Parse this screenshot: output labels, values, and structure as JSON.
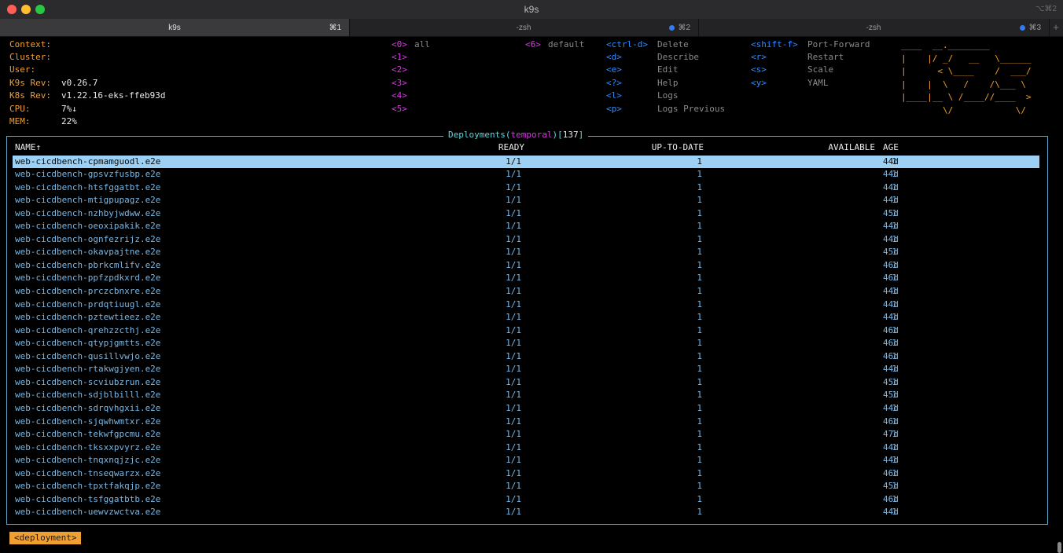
{
  "window": {
    "title": "k9s",
    "shortcut": "⌥⌘2"
  },
  "tabs": [
    {
      "label": "k9s",
      "key": "⌘1",
      "active": true,
      "dot": false
    },
    {
      "label": "-zsh",
      "key": "⌘2",
      "active": false,
      "dot": true
    },
    {
      "label": "-zsh",
      "key": "⌘3",
      "active": false,
      "dot": true
    }
  ],
  "new_tab_label": "+",
  "info": {
    "context_label": "Context:",
    "cluster_label": "Cluster:",
    "user_label": "User:",
    "k9s_rev_label": "K9s Rev:",
    "k9s_rev": "v0.26.7",
    "k8s_rev_label": "K8s Rev:",
    "k8s_rev": "v1.22.16-eks-ffeb93d",
    "cpu_label": "CPU:",
    "cpu": "7%↓",
    "mem_label": "MEM:",
    "mem": "22%"
  },
  "namespaces": [
    {
      "key": "<0>",
      "label": "all"
    },
    {
      "key": "<1>",
      "label": ""
    },
    {
      "key": "<2>",
      "label": ""
    },
    {
      "key": "<3>",
      "label": ""
    },
    {
      "key": "<4>",
      "label": ""
    },
    {
      "key": "<5>",
      "label": ""
    },
    {
      "key": "<6>",
      "label": "default"
    }
  ],
  "hotkeys_col1": [
    {
      "key": "<ctrl-d>",
      "label": "Delete"
    },
    {
      "key": "<d>",
      "label": "Describe"
    },
    {
      "key": "<e>",
      "label": "Edit"
    },
    {
      "key": "<?>",
      "label": "Help"
    },
    {
      "key": "<l>",
      "label": "Logs"
    },
    {
      "key": "<p>",
      "label": "Logs Previous"
    }
  ],
  "hotkeys_col2": [
    {
      "key": "<shift-f>",
      "label": "Port-Forward"
    },
    {
      "key": "<r>",
      "label": "Restart"
    },
    {
      "key": "<s>",
      "label": "Scale"
    },
    {
      "key": "<y>",
      "label": "YAML"
    }
  ],
  "logo": "____  __.________\n|    |/ _/   __   \\______\n|      < \\____    /  ___/\n|    |  \\   /    /\\___ \\\n|____|__ \\ /____//____  >\n        \\/            \\/",
  "table": {
    "title_prefix": "Deployments(",
    "namespace": "temporal",
    "title_mid": ")[",
    "count": "137",
    "title_suffix": "]",
    "headers": {
      "name": "NAME↑",
      "ready": "READY",
      "up_to_date": "UP-TO-DATE",
      "available": "AVAILABLE",
      "age": "AGE"
    },
    "selected_index": 0,
    "rows": [
      {
        "name": "web-cicdbench-cpmamguodl.e2e",
        "ready": "1/1",
        "up_to_date": "1",
        "available": "1",
        "age": "44d"
      },
      {
        "name": "web-cicdbench-gpsvzfusbp.e2e",
        "ready": "1/1",
        "up_to_date": "1",
        "available": "1",
        "age": "44d"
      },
      {
        "name": "web-cicdbench-htsfggatbt.e2e",
        "ready": "1/1",
        "up_to_date": "1",
        "available": "1",
        "age": "44d"
      },
      {
        "name": "web-cicdbench-mtigpupagz.e2e",
        "ready": "1/1",
        "up_to_date": "1",
        "available": "1",
        "age": "44d"
      },
      {
        "name": "web-cicdbench-nzhbyjwdww.e2e",
        "ready": "1/1",
        "up_to_date": "1",
        "available": "1",
        "age": "45d"
      },
      {
        "name": "web-cicdbench-oeoxipakik.e2e",
        "ready": "1/1",
        "up_to_date": "1",
        "available": "1",
        "age": "44d"
      },
      {
        "name": "web-cicdbench-ognfezrijz.e2e",
        "ready": "1/1",
        "up_to_date": "1",
        "available": "1",
        "age": "44d"
      },
      {
        "name": "web-cicdbench-okavpajtne.e2e",
        "ready": "1/1",
        "up_to_date": "1",
        "available": "1",
        "age": "45d"
      },
      {
        "name": "web-cicdbench-pbrkcmlifv.e2e",
        "ready": "1/1",
        "up_to_date": "1",
        "available": "1",
        "age": "46d"
      },
      {
        "name": "web-cicdbench-ppfzpdkxrd.e2e",
        "ready": "1/1",
        "up_to_date": "1",
        "available": "1",
        "age": "46d"
      },
      {
        "name": "web-cicdbench-prczcbnxre.e2e",
        "ready": "1/1",
        "up_to_date": "1",
        "available": "1",
        "age": "44d"
      },
      {
        "name": "web-cicdbench-prdqtiuugl.e2e",
        "ready": "1/1",
        "up_to_date": "1",
        "available": "1",
        "age": "44d"
      },
      {
        "name": "web-cicdbench-pztewtieez.e2e",
        "ready": "1/1",
        "up_to_date": "1",
        "available": "1",
        "age": "44d"
      },
      {
        "name": "web-cicdbench-qrehzzcthj.e2e",
        "ready": "1/1",
        "up_to_date": "1",
        "available": "1",
        "age": "46d"
      },
      {
        "name": "web-cicdbench-qtypjgmtts.e2e",
        "ready": "1/1",
        "up_to_date": "1",
        "available": "1",
        "age": "46d"
      },
      {
        "name": "web-cicdbench-qusillvwjo.e2e",
        "ready": "1/1",
        "up_to_date": "1",
        "available": "1",
        "age": "46d"
      },
      {
        "name": "web-cicdbench-rtakwgjyen.e2e",
        "ready": "1/1",
        "up_to_date": "1",
        "available": "1",
        "age": "44d"
      },
      {
        "name": "web-cicdbench-scviubzrun.e2e",
        "ready": "1/1",
        "up_to_date": "1",
        "available": "1",
        "age": "45d"
      },
      {
        "name": "web-cicdbench-sdjblbilll.e2e",
        "ready": "1/1",
        "up_to_date": "1",
        "available": "1",
        "age": "45d"
      },
      {
        "name": "web-cicdbench-sdrqvhgxii.e2e",
        "ready": "1/1",
        "up_to_date": "1",
        "available": "1",
        "age": "44d"
      },
      {
        "name": "web-cicdbench-sjqwhwmtxr.e2e",
        "ready": "1/1",
        "up_to_date": "1",
        "available": "1",
        "age": "46d"
      },
      {
        "name": "web-cicdbench-tekwfgpcmu.e2e",
        "ready": "1/1",
        "up_to_date": "1",
        "available": "1",
        "age": "47d"
      },
      {
        "name": "web-cicdbench-tksxxpvyrz.e2e",
        "ready": "1/1",
        "up_to_date": "1",
        "available": "1",
        "age": "44d"
      },
      {
        "name": "web-cicdbench-tnqxnqjzjc.e2e",
        "ready": "1/1",
        "up_to_date": "1",
        "available": "1",
        "age": "44d"
      },
      {
        "name": "web-cicdbench-tnseqwarzx.e2e",
        "ready": "1/1",
        "up_to_date": "1",
        "available": "1",
        "age": "46d"
      },
      {
        "name": "web-cicdbench-tpxtfakqjp.e2e",
        "ready": "1/1",
        "up_to_date": "1",
        "available": "1",
        "age": "45d"
      },
      {
        "name": "web-cicdbench-tsfggatbtb.e2e",
        "ready": "1/1",
        "up_to_date": "1",
        "available": "1",
        "age": "46d"
      },
      {
        "name": "web-cicdbench-uewvzwctva.e2e",
        "ready": "1/1",
        "up_to_date": "1",
        "available": "1",
        "age": "44d"
      }
    ]
  },
  "breadcrumb": "<deployment>",
  "colors": {
    "accent_orange": "#f0a030",
    "hotkey_blue": "#2e8cff",
    "namespace_magenta": "#d63ae0",
    "row_text": "#79b8e6",
    "selected_row_bg": "#9dd0f5",
    "frame_border": "#5fa8c8"
  }
}
